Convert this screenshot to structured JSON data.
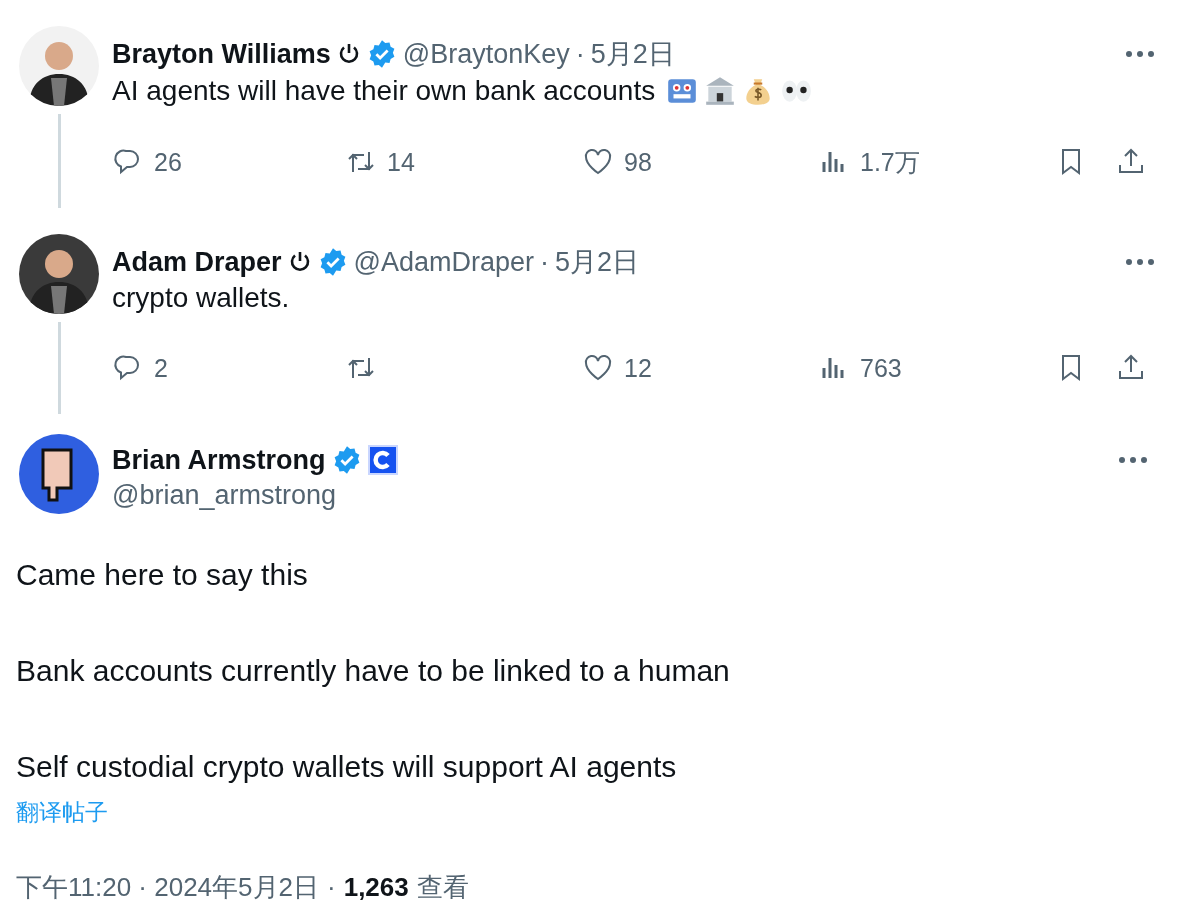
{
  "thread": [
    {
      "name": "Brayton Williams",
      "power_icon": true,
      "verified": true,
      "handle": "@BraytonKey",
      "separator": "·",
      "date": "5月2日",
      "text": "AI agents will have their own bank accounts",
      "emojis": [
        {
          "kind": "robot"
        },
        {
          "kind": "bank"
        },
        {
          "kind": "money-bag"
        },
        {
          "kind": "eyes"
        }
      ],
      "stats": [
        {
          "kind": "reply",
          "count": "26"
        },
        {
          "kind": "repost",
          "count": "14"
        },
        {
          "kind": "like",
          "count": "98"
        },
        {
          "kind": "views",
          "count": "1.7万"
        },
        {
          "kind": "bookmark"
        },
        {
          "kind": "share"
        }
      ]
    },
    {
      "name": "Adam Draper",
      "power_icon": true,
      "verified": true,
      "handle": "@AdamDraper",
      "separator": "·",
      "date": "5月2日",
      "text": "crypto wallets.",
      "stats": [
        {
          "kind": "reply",
          "count": "2"
        },
        {
          "kind": "repost"
        },
        {
          "kind": "like",
          "count": "12"
        },
        {
          "kind": "views",
          "count": "763"
        },
        {
          "kind": "bookmark"
        },
        {
          "kind": "share"
        }
      ]
    }
  ],
  "main": {
    "name": "Brian Armstrong",
    "verified": true,
    "org_badge": true,
    "handle": "@brian_armstrong",
    "paragraphs": [
      "Came here to say this",
      "Bank accounts currently have to be linked to a human",
      "Self custodial crypto wallets will support AI agents"
    ],
    "translate_link": "翻译帖子",
    "time": "下午11:20 · 2024年5月2日",
    "separator": "·",
    "view_count": "1,263",
    "view_label": "查看"
  }
}
